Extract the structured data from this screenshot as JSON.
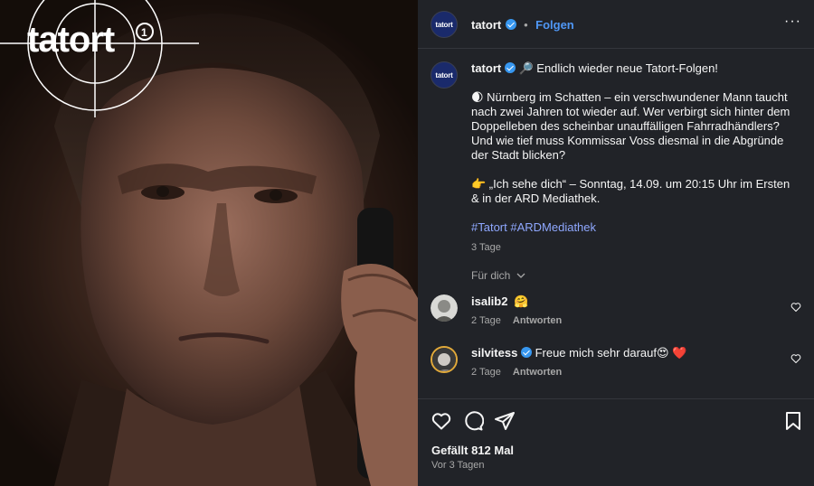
{
  "media": {
    "logo_text": "tatort"
  },
  "header": {
    "username": "tatort",
    "separator": "•",
    "follow_label": "Folgen",
    "more_label": "···",
    "avatar_text": "tatort"
  },
  "caption": {
    "username": "tatort",
    "line1": "🔎 Endlich wieder neue Tatort-Folgen!",
    "para2": "🌒 Nürnberg im Schatten – ein verschwundener Mann taucht nach zwei Jahren tot wieder auf. Wer verbirgt sich hinter dem Doppelleben des scheinbar unauffälligen Fahrradhändlers? Und wie tief muss Kommissar Voss diesmal in die Abgründe der Stadt blicken?",
    "para3": "👉 „Ich sehe dich“ – Sonntag, 14.09. um 20:15 Uhr im Ersten & in der ARD Mediathek.",
    "hashtags": "#Tatort #ARDMediathek",
    "time": "3 Tage"
  },
  "fuer_dich": "Für dich",
  "comments": [
    {
      "username": "isalib2",
      "text": "🤗",
      "time": "2 Tage",
      "reply": "Antworten"
    },
    {
      "username": "silvitess",
      "text": "Freue mich sehr darauf😍 ❤️",
      "time": "2 Tage",
      "reply": "Antworten"
    }
  ],
  "footer": {
    "likes": "Gefällt 812 Mal",
    "posted": "Vor 3 Tagen"
  },
  "colors": {
    "panel_bg": "#212328",
    "link_blue": "#4f97f5",
    "hashtag": "#8fa8ff",
    "verified": "#3797f0"
  },
  "icons": [
    "like-icon",
    "comment-icon",
    "share-icon",
    "save-icon",
    "more-icon",
    "verified-icon",
    "chevron-down-icon"
  ]
}
